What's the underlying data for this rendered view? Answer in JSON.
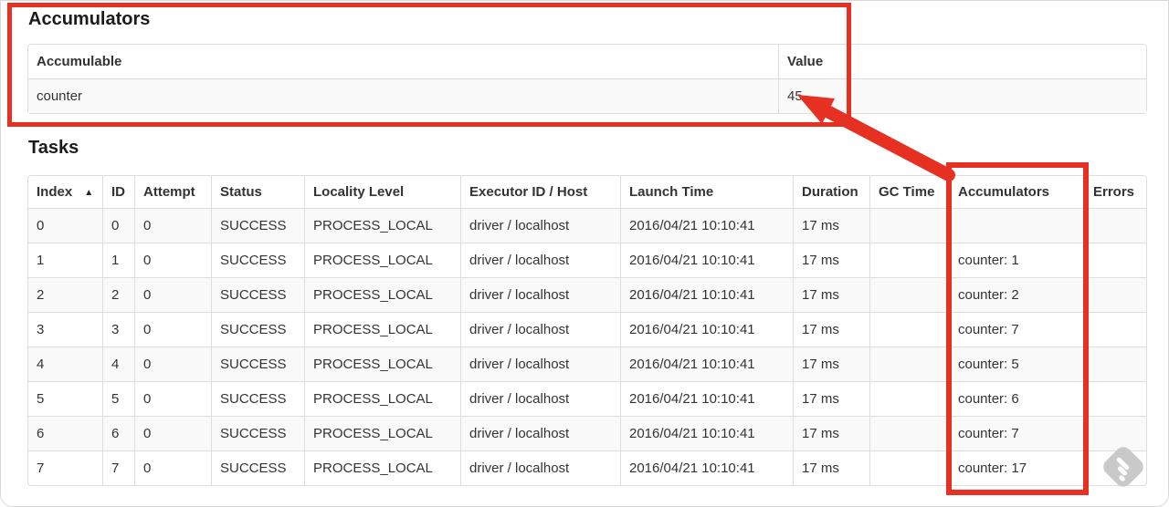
{
  "accumulators_section": {
    "heading": "Accumulators",
    "columns": [
      "Accumulable",
      "Value"
    ],
    "rows": [
      [
        "counter",
        "45"
      ]
    ]
  },
  "tasks_section": {
    "heading": "Tasks",
    "columns": [
      "Index",
      "ID",
      "Attempt",
      "Status",
      "Locality Level",
      "Executor ID / Host",
      "Launch Time",
      "Duration",
      "GC Time",
      "Accumulators",
      "Errors"
    ],
    "sort_icon": "▲",
    "rows": [
      [
        "0",
        "0",
        "0",
        "SUCCESS",
        "PROCESS_LOCAL",
        "driver / localhost",
        "2016/04/21 10:10:41",
        "17 ms",
        "",
        "",
        ""
      ],
      [
        "1",
        "1",
        "0",
        "SUCCESS",
        "PROCESS_LOCAL",
        "driver / localhost",
        "2016/04/21 10:10:41",
        "17 ms",
        "",
        "counter: 1",
        ""
      ],
      [
        "2",
        "2",
        "0",
        "SUCCESS",
        "PROCESS_LOCAL",
        "driver / localhost",
        "2016/04/21 10:10:41",
        "17 ms",
        "",
        "counter: 2",
        ""
      ],
      [
        "3",
        "3",
        "0",
        "SUCCESS",
        "PROCESS_LOCAL",
        "driver / localhost",
        "2016/04/21 10:10:41",
        "17 ms",
        "",
        "counter: 7",
        ""
      ],
      [
        "4",
        "4",
        "0",
        "SUCCESS",
        "PROCESS_LOCAL",
        "driver / localhost",
        "2016/04/21 10:10:41",
        "17 ms",
        "",
        "counter: 5",
        ""
      ],
      [
        "5",
        "5",
        "0",
        "SUCCESS",
        "PROCESS_LOCAL",
        "driver / localhost",
        "2016/04/21 10:10:41",
        "17 ms",
        "",
        "counter: 6",
        ""
      ],
      [
        "6",
        "6",
        "0",
        "SUCCESS",
        "PROCESS_LOCAL",
        "driver / localhost",
        "2016/04/21 10:10:41",
        "17 ms",
        "",
        "counter: 7",
        ""
      ],
      [
        "7",
        "7",
        "0",
        "SUCCESS",
        "PROCESS_LOCAL",
        "driver / localhost",
        "2016/04/21 10:10:41",
        "17 ms",
        "",
        "counter: 17",
        ""
      ]
    ]
  },
  "annotations": {
    "highlight_color": "#e63022",
    "watermark_color": "#c9c9c9"
  }
}
